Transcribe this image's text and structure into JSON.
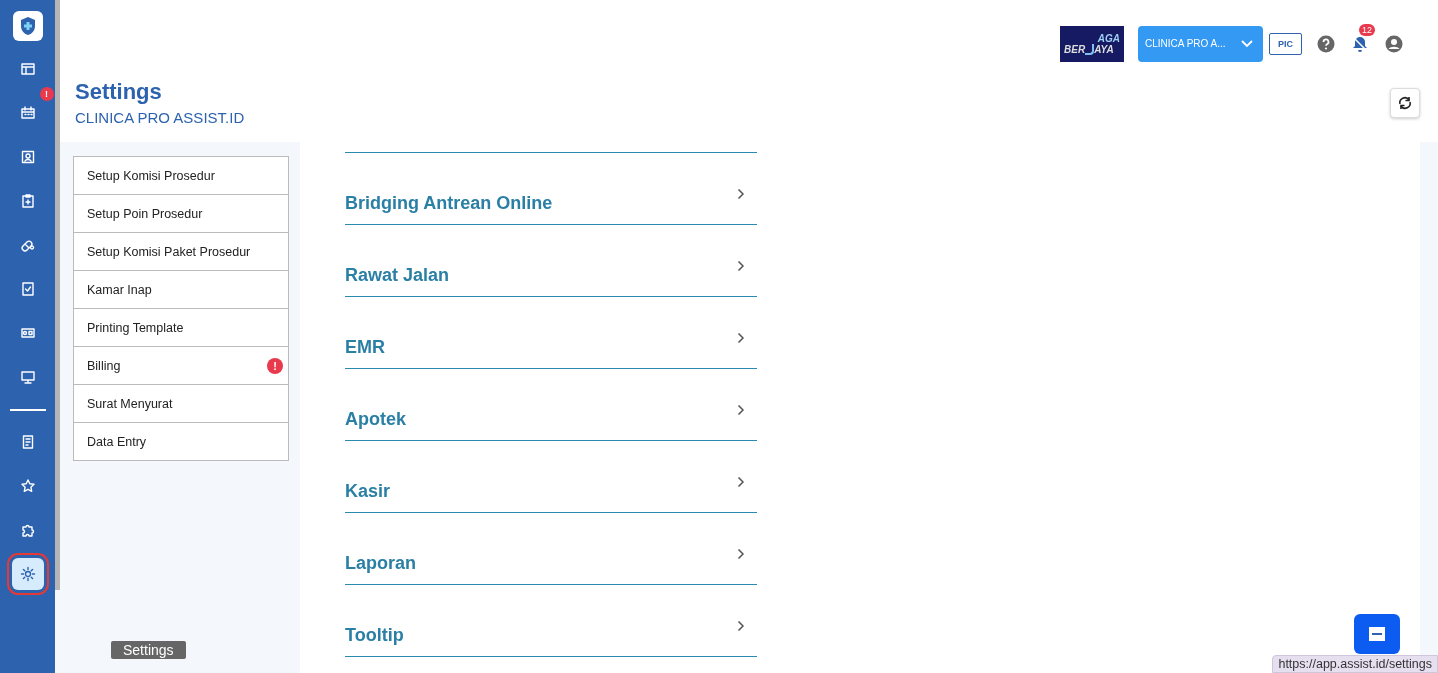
{
  "header": {
    "logo": {
      "top": "AGA",
      "bottom_left": "BER",
      "bottom_right": "AYA"
    },
    "clinic_select": {
      "value": "CLINICA PRO A..."
    },
    "pic_button": "PIC",
    "notifications": {
      "count": "12"
    }
  },
  "sidebar": {
    "main_items": [
      {
        "kind": "dashboard",
        "selected": false
      },
      {
        "kind": "calendar",
        "badge": "!",
        "selected": false
      },
      {
        "kind": "contact",
        "selected": false
      },
      {
        "kind": "clipboard",
        "selected": false
      },
      {
        "kind": "pills",
        "selected": false
      },
      {
        "kind": "checklist",
        "selected": false
      },
      {
        "kind": "card",
        "selected": false
      },
      {
        "kind": "monitor",
        "selected": false
      }
    ],
    "extra_items": [
      {
        "kind": "document",
        "selected": false
      },
      {
        "kind": "star",
        "selected": false
      },
      {
        "kind": "puzzle",
        "selected": false
      },
      {
        "kind": "gear",
        "selected": true
      }
    ],
    "tooltip": "Settings"
  },
  "page": {
    "title": "Settings",
    "subtitle": "CLINICA PRO ASSIST.ID"
  },
  "settings_menu": [
    {
      "label": "Setup Komisi Prosedur"
    },
    {
      "label": "Setup Poin Prosedur"
    },
    {
      "label": "Setup Komisi Paket Prosedur"
    },
    {
      "label": "Kamar Inap"
    },
    {
      "label": "Printing Template"
    },
    {
      "label": "Billing",
      "badge": "!"
    },
    {
      "label": "Surat Menyurat"
    },
    {
      "label": "Data Entry"
    }
  ],
  "sections": [
    {
      "title": "Bridging Antrean Online"
    },
    {
      "title": "Rawat Jalan"
    },
    {
      "title": "EMR"
    },
    {
      "title": "Apotek"
    },
    {
      "title": "Kasir"
    },
    {
      "title": "Laporan"
    },
    {
      "title": "Tooltip"
    }
  ],
  "status_url": "https://app.assist.id/settings"
}
